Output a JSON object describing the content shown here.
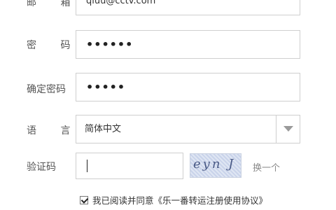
{
  "form": {
    "email": {
      "label": "邮 箱",
      "value": "qiuu@cctv.com"
    },
    "password": {
      "label": "密 码",
      "value": "••••••"
    },
    "confirm_password": {
      "label": "确定密码",
      "value": "•••••"
    },
    "language": {
      "label": "语 言",
      "value": "简体中文",
      "icon": "chevron-down-icon"
    },
    "captcha": {
      "label": "验证码",
      "value": "",
      "image_text": "eyn J",
      "refresh_label": "换一个"
    },
    "agreement": {
      "checked": true,
      "text": "我已阅读并同意《乐一番转运注册使用协议》"
    }
  }
}
